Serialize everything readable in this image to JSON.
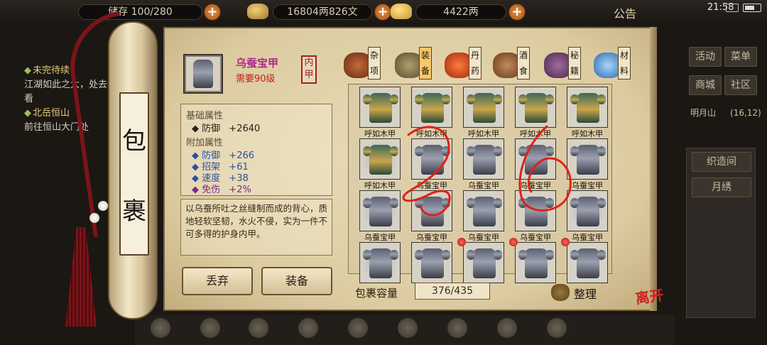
{
  "topbar": {
    "pack_capacity_text": "储存 100/280",
    "money_text": "16804两826文",
    "gold_text": "4422两",
    "notice_label": "公告",
    "clock": "21:58"
  },
  "quest": {
    "items": [
      {
        "title": "未完待续",
        "desc": "江湖如此之大，处去看看"
      },
      {
        "title": "北岳恒山",
        "desc": "前往恒山大门处"
      }
    ]
  },
  "right_menu": {
    "buttons": [
      "活动",
      "菜单",
      "商城",
      "社区"
    ],
    "location_name": "明月山",
    "location_coords": "(16,12)",
    "sub_buttons": [
      "织造间",
      "月绣"
    ]
  },
  "scroll": {
    "title_char_1": "包",
    "title_char_2": "裹"
  },
  "item": {
    "icon": "silkworm-armor-icon",
    "name": "乌蚕宝甲",
    "level_req": "需要90级",
    "type_char_1": "内",
    "type_char_2": "甲",
    "base_header": "基础属性",
    "base_stat": "防御",
    "base_value": "+2640",
    "extra_header": "附加属性",
    "extra": [
      {
        "name": "防御",
        "value": "+266",
        "color": "#2e4fa0"
      },
      {
        "name": "招架",
        "value": "+61",
        "color": "#2e4fa0"
      },
      {
        "name": "速度",
        "value": "+38",
        "color": "#2e4fa0"
      },
      {
        "name": "免伤",
        "value": "+2%",
        "color": "#7a2a8a"
      }
    ],
    "description": "以乌蚕所吐之丝缝制而成的背心，质地轻软坚韧，水火不侵，实为一件不可多得的护身内甲。"
  },
  "actions": {
    "discard_label": "丢弃",
    "equip_label": "装备"
  },
  "categories": [
    {
      "label": "杂项",
      "icon": "jar-icon",
      "color": "#9a4a2a"
    },
    {
      "label": "装备",
      "icon": "weapon-icon",
      "color": "#7a6a4a"
    },
    {
      "label": "丹药",
      "icon": "pill-icon",
      "color": "#d0542a"
    },
    {
      "label": "酒食",
      "icon": "wine-food-icon",
      "color": "#8a5a3a"
    },
    {
      "label": "秘籍",
      "icon": "book-icon",
      "color": "#6a4a7a"
    },
    {
      "label": "材料",
      "icon": "crystal-icon",
      "color": "#5a90c8"
    }
  ],
  "grid": {
    "slots": [
      {
        "name": "呼如木甲",
        "kind": "gold",
        "glow": false,
        "dot": false
      },
      {
        "name": "呼如木甲",
        "kind": "gold",
        "glow": false,
        "dot": false
      },
      {
        "name": "呼如木甲",
        "kind": "gold",
        "glow": false,
        "dot": false
      },
      {
        "name": "呼如木甲",
        "kind": "gold",
        "glow": false,
        "dot": false
      },
      {
        "name": "呼如木甲",
        "kind": "gold",
        "glow": false,
        "dot": false
      },
      {
        "name": "呼如木甲",
        "kind": "gold",
        "glow": true,
        "dot": false
      },
      {
        "name": "乌蚕宝甲",
        "kind": "silk",
        "glow": false,
        "dot": false
      },
      {
        "name": "乌蚕宝甲",
        "kind": "silk",
        "glow": false,
        "dot": false
      },
      {
        "name": "乌蚕宝甲",
        "kind": "silk",
        "glow": false,
        "dot": false
      },
      {
        "name": "乌蚕宝甲",
        "kind": "silk",
        "glow": false,
        "dot": false
      },
      {
        "name": "乌蚕宝甲",
        "kind": "silk",
        "glow": true,
        "dot": false
      },
      {
        "name": "乌蚕宝甲",
        "kind": "silk",
        "glow": false,
        "dot": false
      },
      {
        "name": "乌蚕宝甲",
        "kind": "silk",
        "glow": false,
        "dot": false
      },
      {
        "name": "乌蚕宝甲",
        "kind": "silk",
        "glow": false,
        "dot": false
      },
      {
        "name": "乌蚕宝甲",
        "kind": "silk",
        "glow": true,
        "dot": false
      },
      {
        "name": "",
        "kind": "silk",
        "glow": true,
        "dot": false
      },
      {
        "name": "",
        "kind": "silk",
        "glow": false,
        "dot": false
      },
      {
        "name": "",
        "kind": "silk",
        "glow": false,
        "dot": true
      },
      {
        "name": "",
        "kind": "silk",
        "glow": false,
        "dot": true
      },
      {
        "name": "",
        "kind": "silk",
        "glow": false,
        "dot": true
      }
    ]
  },
  "capacity": {
    "label": "包裹容量",
    "value": "376/435"
  },
  "sort_label": "整理",
  "leave_label": "离开",
  "colors": {
    "accent_red": "#d22020",
    "item_name": "#b0268f",
    "annotation": "#e0201a"
  }
}
